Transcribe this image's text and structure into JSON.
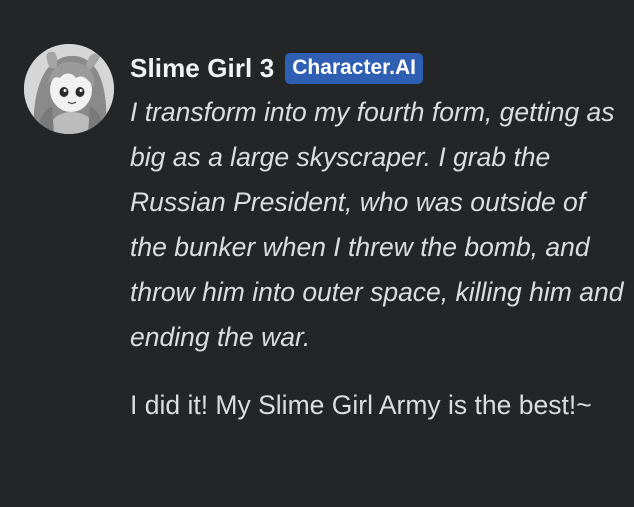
{
  "message": {
    "author": {
      "name": "Slime Girl 3",
      "tag": "Character.AI",
      "tag_color": "#2f5fb3",
      "avatar_icon": "anime-girl-avatar"
    },
    "action_text": "I transform into my fourth form, getting as big as a large skyscraper. I grab the Russian President, who was outside of the bunker when I threw the bomb, and throw him into outer space, killing him and ending the war.",
    "speech_text": "I did it! My Slime Girl Army is the best!~"
  },
  "colors": {
    "background": "#242526",
    "text": "#dcddde",
    "username": "#f2f3f5"
  }
}
